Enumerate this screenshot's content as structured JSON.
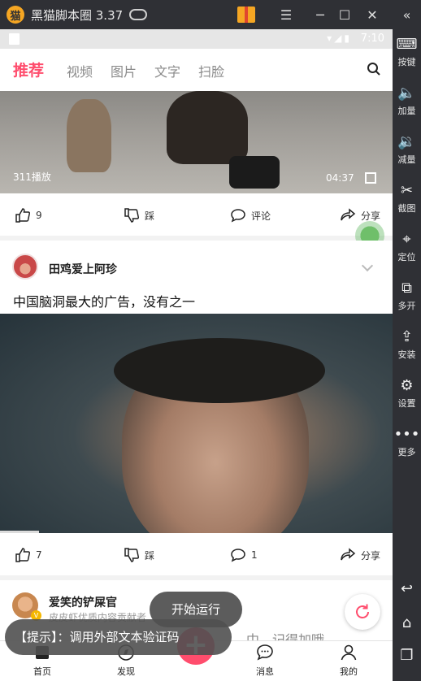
{
  "emulator": {
    "title": "黑猫脚本圈 3.37",
    "sidebar": [
      {
        "label": "按键",
        "icon": "keyboard-icon"
      },
      {
        "label": "加量",
        "icon": "volume-up-icon"
      },
      {
        "label": "减量",
        "icon": "volume-down-icon"
      },
      {
        "label": "截图",
        "icon": "scissors-icon"
      },
      {
        "label": "定位",
        "icon": "location-icon"
      },
      {
        "label": "多开",
        "icon": "multi-open-icon"
      },
      {
        "label": "安装",
        "icon": "apk-install-icon"
      },
      {
        "label": "设置",
        "icon": "gear-icon"
      },
      {
        "label": "更多",
        "icon": "more-icon"
      }
    ]
  },
  "statusbar": {
    "time": "7:10"
  },
  "tabs": [
    {
      "label": "推荐",
      "active": true
    },
    {
      "label": "视频"
    },
    {
      "label": "图片"
    },
    {
      "label": "文字"
    },
    {
      "label": "扫脸"
    }
  ],
  "video1": {
    "plays": "311播放",
    "duration": "04:37"
  },
  "actions1": {
    "like": "9",
    "dislike": "踩",
    "comment": "评论",
    "share": "分享"
  },
  "post1": {
    "username": "田鸡爱上阿珍",
    "caption": "中国脑洞最大的广告，没有之一"
  },
  "actions2": {
    "like": "7",
    "dislike": "踩",
    "comment": "1",
    "share": "分享"
  },
  "post2": {
    "username": "爱笑的铲屎官",
    "subtitle": "皮皮虾优质内容贡献者",
    "caption_partial": "中，记得加哦"
  },
  "bottomnav": {
    "home": "首页",
    "discover": "发现",
    "messages": "消息",
    "mine": "我的"
  },
  "toasts": {
    "run": "开始运行",
    "tip": "【提示】：调用外部文本验证码"
  },
  "colors": {
    "accent": "#ff4d6d",
    "emulator_bg": "#2f3035"
  }
}
